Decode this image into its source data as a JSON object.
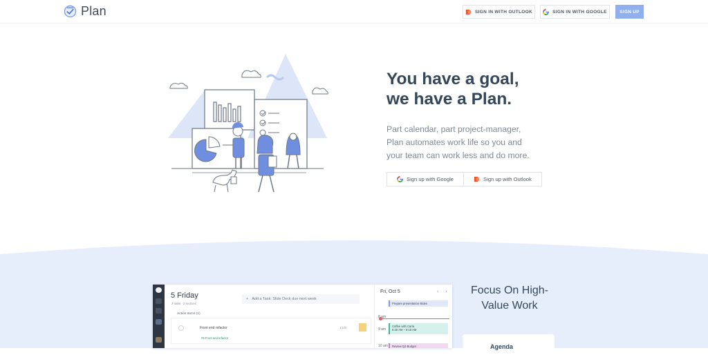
{
  "header": {
    "logo_text": "Plan",
    "logo_icon": "check-circle-icon",
    "outlook_label": "SIGN IN WITH OUTLOOK",
    "google_label": "SIGN IN WITH GOOGLE",
    "signup_label": "SIGN UP"
  },
  "hero": {
    "title_lines": [
      "You have a goal,",
      "we have a Plan."
    ],
    "subtitle_lines": [
      "Part calendar, part project-manager,",
      "Plan automates work life so you and",
      "your team can work less and do more."
    ],
    "google_button": "Sign up with Google",
    "outlook_button": "Sign up with Outlook"
  },
  "app_preview": {
    "day_title": "5 Friday",
    "day_meta": "2 tasks · 2 sections",
    "add_task_placeholder": "Add a Task: Slide Deck due next week",
    "action_items_header": "Action Items (1)",
    "task": {
      "name": "Front end refactor",
      "duration": "1.5 hr",
      "project": "#9 Front end refactor"
    },
    "calendar": {
      "title": "Fri, Oct 5",
      "nav": "‹ ›",
      "hours": [
        "8 am",
        "9 am",
        "10 am"
      ],
      "events": [
        {
          "title": "Prepare presentation slides",
          "time": ""
        },
        {
          "title": "Coffee with Carla",
          "time": "8:30 AM – 9:15 AM"
        },
        {
          "title": "Review Q3 Budget",
          "time": ""
        }
      ]
    }
  },
  "feature": {
    "title_lines": [
      "Focus On High-",
      "Value Work"
    ],
    "card_label": "Agenda"
  },
  "colors": {
    "accent": "#8fb0ec",
    "illustration_blue": "#6f8ee0",
    "band_background": "#e7eefb",
    "heading": "#33475b"
  }
}
